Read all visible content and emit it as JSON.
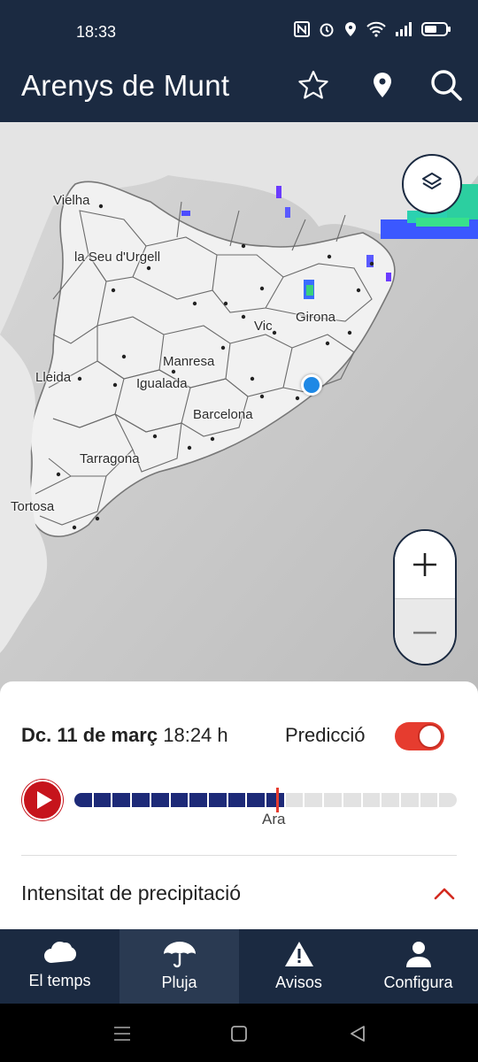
{
  "status_bar": {
    "time": "18:33",
    "icons": [
      "nfc-icon",
      "alarm-icon",
      "location-icon",
      "wifi-icon",
      "signal-icon",
      "battery-icon"
    ]
  },
  "header": {
    "title": "Arenys de Munt",
    "actions": [
      "star-icon",
      "location-pin-icon",
      "search-icon"
    ]
  },
  "map": {
    "city_labels": [
      "Vielha",
      "la Seu d'Urgell",
      "Girona",
      "Vic",
      "Manresa",
      "Lleida",
      "Igualada",
      "Barcelona",
      "Tarragona",
      "Tortosa"
    ],
    "controls": {
      "layers_icon": "layers-icon",
      "zoom_in": "+",
      "zoom_out": "−"
    }
  },
  "player": {
    "date": "Dc. 11 de març",
    "time": "18:24 h",
    "prediction_label": "Predicció",
    "prediction_enabled": true,
    "now_label": "Ara",
    "timeline_past_fraction": 0.54
  },
  "section": {
    "title": "Intensitat de precipitació"
  },
  "bottom_nav": {
    "items": [
      {
        "label": "El temps",
        "icon": "cloud-icon"
      },
      {
        "label": "Pluja",
        "icon": "umbrella-icon"
      },
      {
        "label": "Avisos",
        "icon": "warning-icon"
      },
      {
        "label": "Configura",
        "icon": "user-icon"
      }
    ],
    "active_index": 1
  },
  "colors": {
    "header_bg": "#1b2a41",
    "accent_red": "#e63c2f",
    "timeline_past": "#1d2a78",
    "location_dot": "#1e88e5"
  }
}
